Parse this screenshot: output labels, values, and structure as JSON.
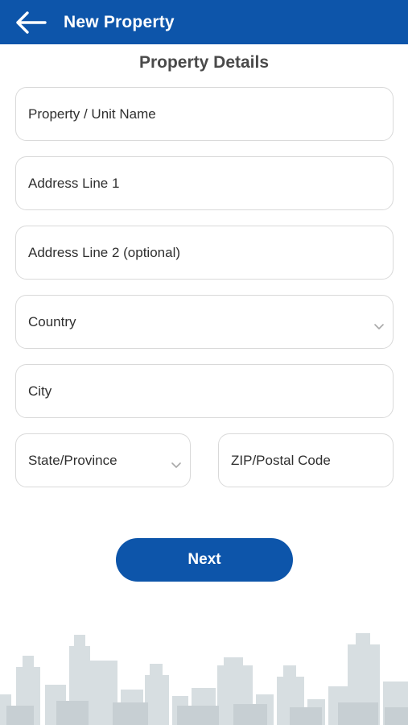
{
  "header": {
    "title": "New Property",
    "back_icon": "arrow-left-icon"
  },
  "form": {
    "section_title": "Property Details",
    "property_name_placeholder": "Property / Unit Name",
    "address1_placeholder": "Address Line 1",
    "address2_placeholder": "Address Line 2 (optional)",
    "country_placeholder": "Country",
    "city_placeholder": "City",
    "state_placeholder": "State/Province",
    "zip_placeholder": "ZIP/Postal Code",
    "next_label": "Next"
  },
  "colors": {
    "brand": "#0d55aa",
    "field_border": "#d9d9d9",
    "skyline": "#d5dcdf"
  }
}
